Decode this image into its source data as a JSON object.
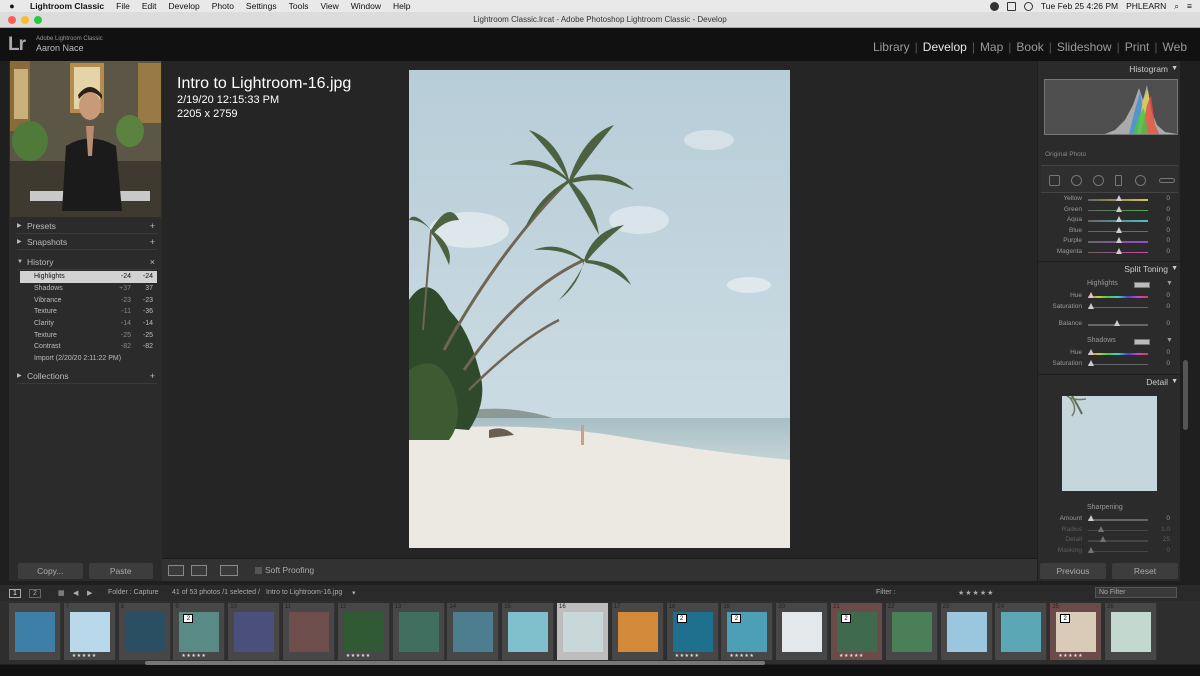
{
  "mac_menu": {
    "app": "Lightroom Classic",
    "items": [
      "File",
      "Edit",
      "Develop",
      "Photo",
      "Settings",
      "Tools",
      "View",
      "Window",
      "Help"
    ],
    "clock": "Tue Feb 25  4:26 PM",
    "user": "PHLEARN"
  },
  "window_title": "Lightroom Classic.lrcat - Adobe Photoshop Lightroom Classic - Develop",
  "identity": {
    "logo": "Lr",
    "product": "Adobe Lightroom Classic",
    "name": "Aaron Nace"
  },
  "modules": [
    "Library",
    "Develop",
    "Map",
    "Book",
    "Slideshow",
    "Print",
    "Web"
  ],
  "active_module": "Develop",
  "left_panel": {
    "presets": "Presets",
    "snapshots": "Snapshots",
    "history": "History",
    "collections": "Collections",
    "history_items": [
      {
        "label": "Highlights",
        "v1": "-24",
        "v2": "-24"
      },
      {
        "label": "Shadows",
        "v1": "+37",
        "v2": "37"
      },
      {
        "label": "Vibrance",
        "v1": "-23",
        "v2": "-23"
      },
      {
        "label": "Texture",
        "v1": "-11",
        "v2": "-36"
      },
      {
        "label": "Clarity",
        "v1": "-14",
        "v2": "-14"
      },
      {
        "label": "Texture",
        "v1": "-25",
        "v2": "-25"
      },
      {
        "label": "Contrast",
        "v1": "-82",
        "v2": "-82"
      },
      {
        "label": "Import (2/20/20 2:11:22 PM)",
        "v1": "",
        "v2": ""
      }
    ],
    "copy_label": "Copy...",
    "paste_label": "Paste"
  },
  "photo": {
    "filename": "Intro to Lightroom-16.jpg",
    "datetime": "2/19/20 12:15:33 PM",
    "dimensions": "2205 x 2759"
  },
  "toolbar": {
    "soft_proofing": "Soft Proofing"
  },
  "right_panel": {
    "histogram": "Histogram",
    "original_photo": "Original Photo",
    "hsl_rows": [
      {
        "label": "Yellow",
        "value": "0"
      },
      {
        "label": "Green",
        "value": "0"
      },
      {
        "label": "Aqua",
        "value": "0"
      },
      {
        "label": "Blue",
        "value": "0"
      },
      {
        "label": "Purple",
        "value": "0"
      },
      {
        "label": "Magenta",
        "value": "0"
      }
    ],
    "split_toning": "Split Toning",
    "highlights": "Highlights",
    "shadows": "Shadows",
    "split_highlight_rows": [
      {
        "label": "Hue",
        "value": "0"
      },
      {
        "label": "Saturation",
        "value": "0"
      }
    ],
    "balance": {
      "label": "Balance",
      "value": "0"
    },
    "split_shadow_rows": [
      {
        "label": "Hue",
        "value": "0"
      },
      {
        "label": "Saturation",
        "value": "0"
      }
    ],
    "detail": "Detail",
    "sharpening": "Sharpening",
    "sharpen_rows": [
      {
        "label": "Amount",
        "value": "0"
      },
      {
        "label": "Radius",
        "value": "1.0"
      },
      {
        "label": "Detail",
        "value": "25"
      },
      {
        "label": "Masking",
        "value": "0"
      }
    ],
    "previous_label": "Previous",
    "reset_label": "Reset"
  },
  "film_bar": {
    "folder": "Folder : Capture",
    "count": "41 of 53 photos /1 selected /",
    "current": "Intro to Lightroom-16.jpg",
    "filter_label": "Filter :",
    "filter_value": "No Filter",
    "page1": "1",
    "page2": "2"
  },
  "filmstrip": {
    "cells": [
      {
        "num": "",
        "color": "#3e7fa8",
        "badge": "",
        "stars": ""
      },
      {
        "num": "7",
        "color": "#b9d9ea",
        "badge": "",
        "stars": "★★★★★"
      },
      {
        "num": "8",
        "color": "#2b4f62",
        "badge": "",
        "stars": ""
      },
      {
        "num": "9",
        "color": "#5a8a86",
        "badge": "2",
        "stars": "★★★★★"
      },
      {
        "num": "10",
        "color": "#4a4f7c",
        "badge": "",
        "stars": ""
      },
      {
        "num": "11",
        "color": "#6e4e4c",
        "badge": "",
        "stars": ""
      },
      {
        "num": "12",
        "color": "#2f5a34",
        "badge": "",
        "stars": "★★★★★"
      },
      {
        "num": "13",
        "color": "#406f5f",
        "badge": "",
        "stars": ""
      },
      {
        "num": "14",
        "color": "#4c7e8f",
        "badge": "",
        "stars": ""
      },
      {
        "num": "15",
        "color": "#7fc0cc",
        "badge": "",
        "stars": ""
      },
      {
        "num": "16",
        "color": "#c9d7d9",
        "badge": "",
        "stars": ""
      },
      {
        "num": "17",
        "color": "#d28a3a",
        "badge": "",
        "stars": ""
      },
      {
        "num": "18",
        "color": "#1f6f8f",
        "badge": "2",
        "stars": "★★★★★"
      },
      {
        "num": "19",
        "color": "#4d9fb8",
        "badge": "2",
        "stars": "★★★★★"
      },
      {
        "num": "20",
        "color": "#e5e8ea",
        "badge": "",
        "stars": ""
      },
      {
        "num": "21",
        "color": "#3f6a4e",
        "badge": "2",
        "stars": "★★★★★"
      },
      {
        "num": "22",
        "color": "#4b7f57",
        "badge": "",
        "stars": ""
      },
      {
        "num": "23",
        "color": "#9ac7de",
        "badge": "",
        "stars": ""
      },
      {
        "num": "24",
        "color": "#5ca7b6",
        "badge": "",
        "stars": ""
      },
      {
        "num": "25",
        "color": "#d9cbb8",
        "badge": "2",
        "stars": "★★★★★"
      },
      {
        "num": "26",
        "color": "#c3d8cf",
        "badge": "",
        "stars": ""
      }
    ]
  },
  "colors": {
    "panel": "#2b2b2b",
    "background": "#252525",
    "sky": "#c3d5de",
    "sand": "#ece9e3"
  }
}
